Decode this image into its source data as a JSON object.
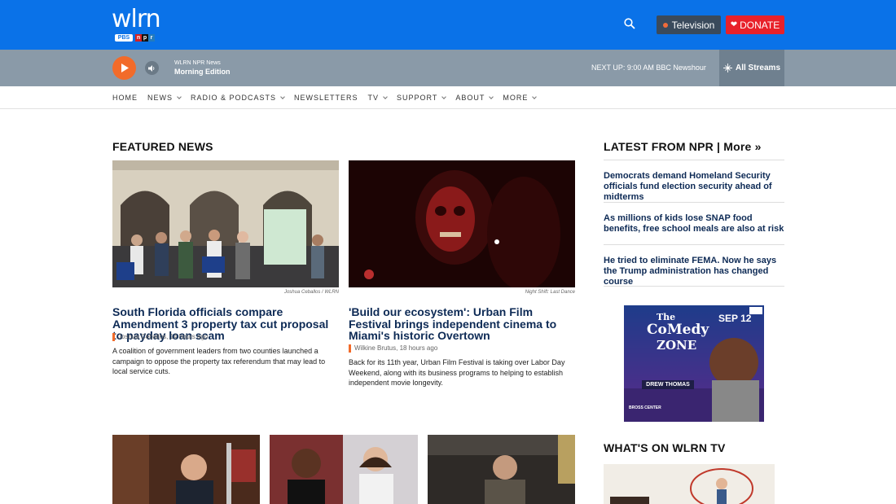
{
  "header": {
    "logo_text": "wlrn",
    "pbs": "PBS",
    "npr_letters": [
      "n",
      "p",
      "r"
    ],
    "tv_button": "Television",
    "donate_button": "DONATE"
  },
  "player": {
    "station": "WLRN NPR News",
    "program": "Morning Edition",
    "next_up_label": "NEXT UP:",
    "next_up_value": "9:00 AM BBC Newshour",
    "streams_button": "All Streams"
  },
  "nav": {
    "items": [
      "HOME",
      "NEWS",
      "RADIO & PODCASTS",
      "NEWSLETTERS",
      "TV",
      "SUPPORT",
      "ABOUT",
      "MORE"
    ]
  },
  "featured": {
    "title": "FEATURED NEWS",
    "stories": [
      {
        "credit": "Joshua Ceballos / WLRN",
        "headline": "South Florida officials compare Amendment 3 property tax cut proposal to payday loan scam",
        "byline": "Joshua Ceballos, 14 hours ago",
        "teaser": "A coalition of government leaders from two counties launched a campaign to oppose the property tax referendum that may lead to local service cuts."
      },
      {
        "credit": "Night Shift: Last Dance",
        "headline": "'Build our ecosystem': Urban Film Festival brings independent cinema to Miami's historic Overtown",
        "byline": "Wilkine Brutus, 18 hours ago",
        "teaser": "Back for its 11th year, Urban Film Festival is taking over Labor Day Weekend, along with its business programs to helping to establish independent movie longevity."
      }
    ]
  },
  "npr": {
    "title": "LATEST FROM NPR | More »",
    "items": [
      "Democrats demand Homeland Security officials fund election security ahead of midterms",
      "As millions of kids lose SNAP food benefits, free school meals are also at risk",
      "He tried to eliminate FEMA. Now he says the Trump administration has changed course"
    ]
  },
  "ad": {
    "line1": "The",
    "line2": "CoMedy",
    "line3": "ZONE",
    "date": "SEP 12",
    "performer": "DREW THOMAS",
    "venue": "BROSS CENTER"
  },
  "wlrn_tv": {
    "title": "WHAT'S ON WLRN TV"
  },
  "colors": {
    "brand_blue": "#0a72e8",
    "player_gray": "#8a9aa8",
    "accent_orange": "#f26b2a",
    "donate_red": "#e8212a",
    "headline_navy": "#0d2a55"
  }
}
